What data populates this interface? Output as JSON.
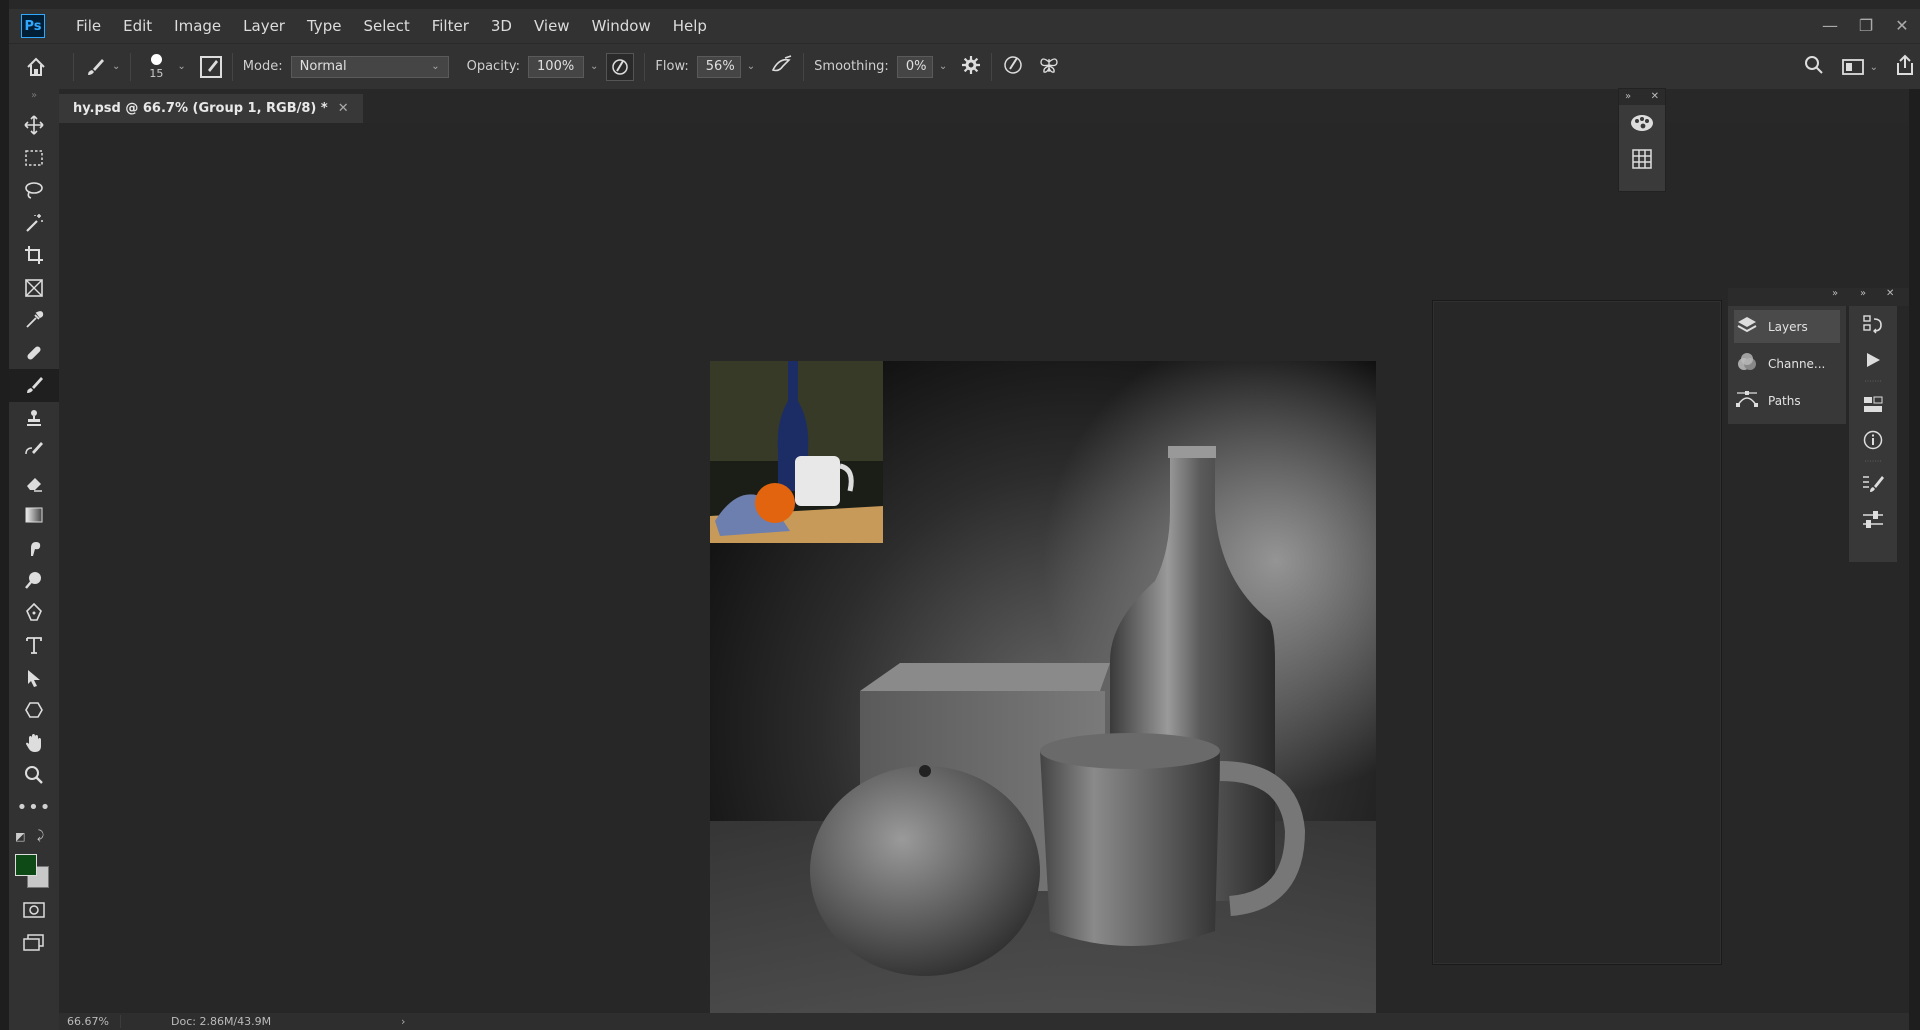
{
  "app": {
    "logo": "Ps"
  },
  "menu": [
    "File",
    "Edit",
    "Image",
    "Layer",
    "Type",
    "Select",
    "Filter",
    "3D",
    "View",
    "Window",
    "Help"
  ],
  "window_controls": {
    "minimize": "—",
    "restore": "❐",
    "close": "✕"
  },
  "options": {
    "brush_size": "15",
    "mode_label": "Mode:",
    "mode_value": "Normal",
    "opacity_label": "Opacity:",
    "opacity_value": "100%",
    "flow_label": "Flow:",
    "flow_value": "56%",
    "smoothing_label": "Smoothing:",
    "smoothing_value": "0%"
  },
  "document_tab": {
    "title": "hy.psd @ 66.7% (Group 1, RGB/8) *",
    "close": "✕"
  },
  "layers_panel": {
    "items": [
      {
        "label": "Layers",
        "icon": "layers-icon",
        "active": true
      },
      {
        "label": "Channe...",
        "icon": "channels-icon",
        "active": false
      },
      {
        "label": "Paths",
        "icon": "paths-icon",
        "active": false
      }
    ]
  },
  "status": {
    "zoom": "66.67%",
    "doc": "Doc: 2.86M/43.9M"
  },
  "colors": {
    "foreground": "#0e4a16",
    "background": "#c8c8c8",
    "accent": "#31a8ff"
  }
}
